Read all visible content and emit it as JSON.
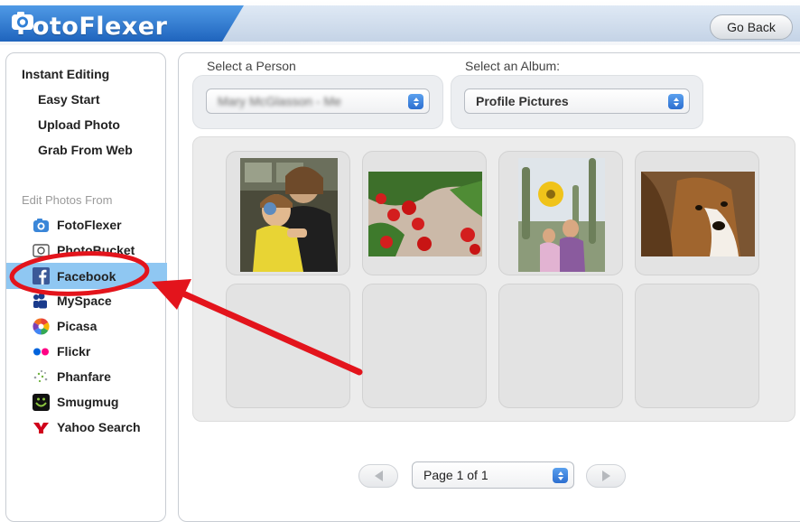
{
  "app": {
    "logo_text": "FotoFlexer",
    "go_back_label": "Go Back"
  },
  "sidebar": {
    "instant_heading": "Instant Editing",
    "instant_links": [
      "Easy Start",
      "Upload Photo",
      "Grab From Web"
    ],
    "sources_heading": "Edit Photos From",
    "sources": [
      {
        "label": "FotoFlexer",
        "icon": "camera-icon"
      },
      {
        "label": "PhotoBucket",
        "icon": "photobucket-icon"
      },
      {
        "label": "Facebook",
        "icon": "facebook-icon",
        "selected": true
      },
      {
        "label": "MySpace",
        "icon": "myspace-icon"
      },
      {
        "label": "Picasa",
        "icon": "picasa-icon"
      },
      {
        "label": "Flickr",
        "icon": "flickr-icon"
      },
      {
        "label": "Phanfare",
        "icon": "phanfare-icon"
      },
      {
        "label": "Smugmug",
        "icon": "smugmug-icon"
      },
      {
        "label": "Yahoo Search",
        "icon": "yahoo-icon"
      }
    ]
  },
  "main": {
    "person_label": "Select a Person",
    "person_value": "Mary McGlasson - Me",
    "album_label": "Select an Album:",
    "album_value": "Profile Pictures",
    "photos": [
      {
        "subject": "child and woman on train"
      },
      {
        "subject": "red flowers"
      },
      {
        "subject": "two women in cactus garden"
      },
      {
        "subject": "collie dog"
      },
      {
        "subject": "empty"
      },
      {
        "subject": "empty"
      },
      {
        "subject": "empty"
      },
      {
        "subject": "empty"
      }
    ],
    "pagination": {
      "page_label": "Page 1 of 1"
    }
  },
  "colors": {
    "brand_blue": "#2f7fd6",
    "selected_row": "#8fc7f2",
    "annotation_red": "#e3141c"
  }
}
